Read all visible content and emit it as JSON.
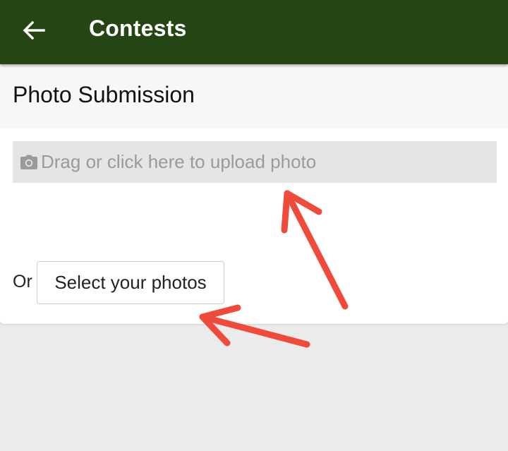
{
  "app_bar": {
    "title": "Contests",
    "back_icon": "arrow-back-icon",
    "background": "#254514"
  },
  "submission": {
    "title": "Photo Submission",
    "dropzone": {
      "icon": "camera-icon",
      "text": "Drag or click here to upload photo"
    },
    "or_label": "Or",
    "select_button_label": "Select your photos"
  },
  "annotations": {
    "arrow_color": "#f04a3a",
    "count": 2
  }
}
